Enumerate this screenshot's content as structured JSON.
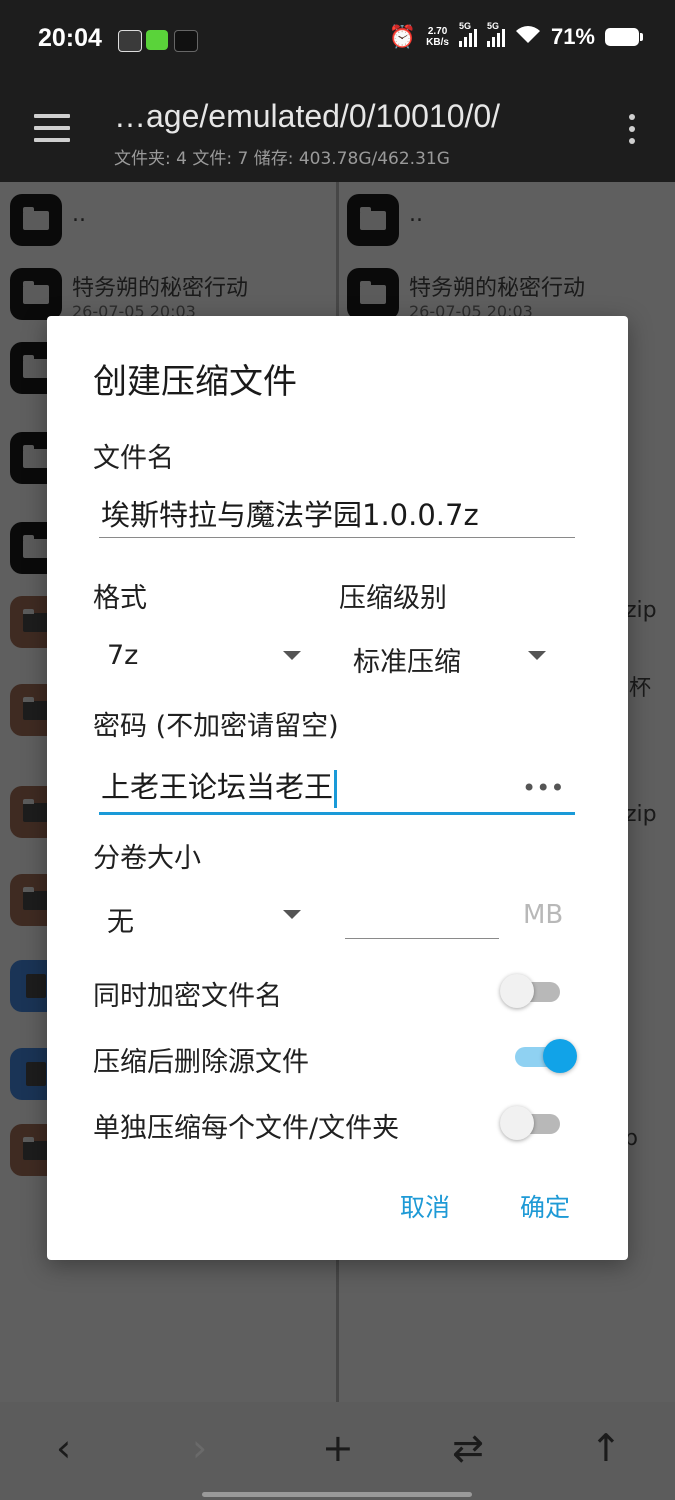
{
  "status_bar": {
    "time": "20:04",
    "net_speed_value": "2.70",
    "net_speed_unit": "KB/s",
    "sim1_tag": "5G",
    "sim2_tag": "5G",
    "battery": "71%",
    "app_icon_colors": [
      "#3a3a3a",
      "#5ad33a",
      "#111111"
    ]
  },
  "toolbar": {
    "path": "…age/emulated/0/10010/0/",
    "info": "文件夹: 4   文件: 7   储存: 403.78G/462.31G"
  },
  "left_pane": {
    "items": [
      {
        "name": "..",
        "type": "folder"
      },
      {
        "name": "特务朔的秘密行动",
        "date": "26-07-05 20:03",
        "type": "folder"
      }
    ]
  },
  "right_pane": {
    "items": [
      {
        "name": "..",
        "type": "folder"
      },
      {
        "name": "特务朔的秘密行动",
        "date": "26-07-05 20:03",
        "type": "folder"
      }
    ],
    "tails": [
      "zip",
      "杯",
      "zip",
      "p"
    ]
  },
  "dialog": {
    "title": "创建压缩文件",
    "filename_label": "文件名",
    "filename_value": "埃斯特拉与魔法学园1.0.0.7z",
    "format_label": "格式",
    "format_value": "7z",
    "level_label": "压缩级别",
    "level_value": "标准压缩",
    "password_label": "密码 (不加密请留空)",
    "password_value": "上老王论坛当老王",
    "password_toggle": "•••",
    "volume_label": "分卷大小",
    "volume_value": "无",
    "volume_unit": "MB",
    "options": [
      {
        "label": "同时加密文件名",
        "on": false
      },
      {
        "label": "压缩后删除源文件",
        "on": true
      },
      {
        "label": "单独压缩每个文件/文件夹",
        "on": false
      }
    ],
    "cancel_label": "取消",
    "ok_label": "确定",
    "accent_color": "#1a9ad8"
  },
  "bottom_bar": {
    "back_icon": "‹",
    "forward_icon": "›",
    "add_icon": "+",
    "swap_icon": "⇄",
    "up_icon": "↑"
  }
}
